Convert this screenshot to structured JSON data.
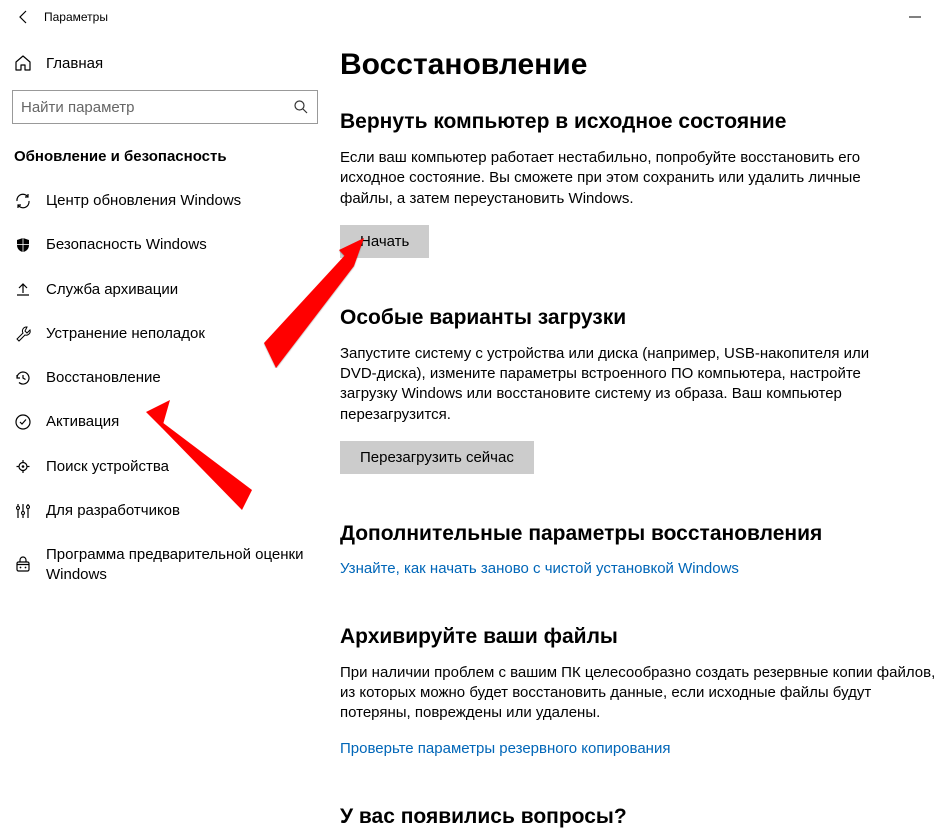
{
  "titlebar": {
    "app_title": "Параметры"
  },
  "sidebar": {
    "home_label": "Главная",
    "search_placeholder": "Найти параметр",
    "category": "Обновление и безопасность",
    "items": [
      {
        "label": "Центр обновления Windows"
      },
      {
        "label": "Безопасность Windows"
      },
      {
        "label": "Служба архивации"
      },
      {
        "label": "Устранение неполадок"
      },
      {
        "label": "Восстановление"
      },
      {
        "label": "Активация"
      },
      {
        "label": "Поиск устройства"
      },
      {
        "label": "Для разработчиков"
      },
      {
        "label": "Программа предварительной оценки Windows"
      }
    ]
  },
  "main": {
    "page_title": "Восстановление",
    "sections": {
      "reset": {
        "title": "Вернуть компьютер в исходное состояние",
        "text": "Если ваш компьютер работает нестабильно, попробуйте восстановить его исходное состояние. Вы сможете при этом сохранить или удалить личные файлы, а затем переустановить Windows.",
        "button": "Начать"
      },
      "advanced_startup": {
        "title": "Особые варианты загрузки",
        "text": "Запустите систему с устройства или диска (например, USB-накопителя или DVD-диска), измените параметры встроенного ПО компьютера, настройте загрузку Windows или восстановите систему из образа. Ваш компьютер перезагрузится.",
        "button": "Перезагрузить сейчас"
      },
      "more_recovery": {
        "title": "Дополнительные параметры восстановления",
        "link": "Узнайте, как начать заново с чистой установкой Windows"
      },
      "backup": {
        "title": "Архивируйте ваши файлы",
        "text": "При наличии проблем с вашим ПК целесообразно создать резервные копии файлов, из которых можно будет восстановить данные, если исходные файлы будут потеряны, повреждены или удалены.",
        "link": "Проверьте параметры резервного копирования"
      },
      "questions": {
        "title": "У вас появились вопросы?"
      }
    }
  }
}
